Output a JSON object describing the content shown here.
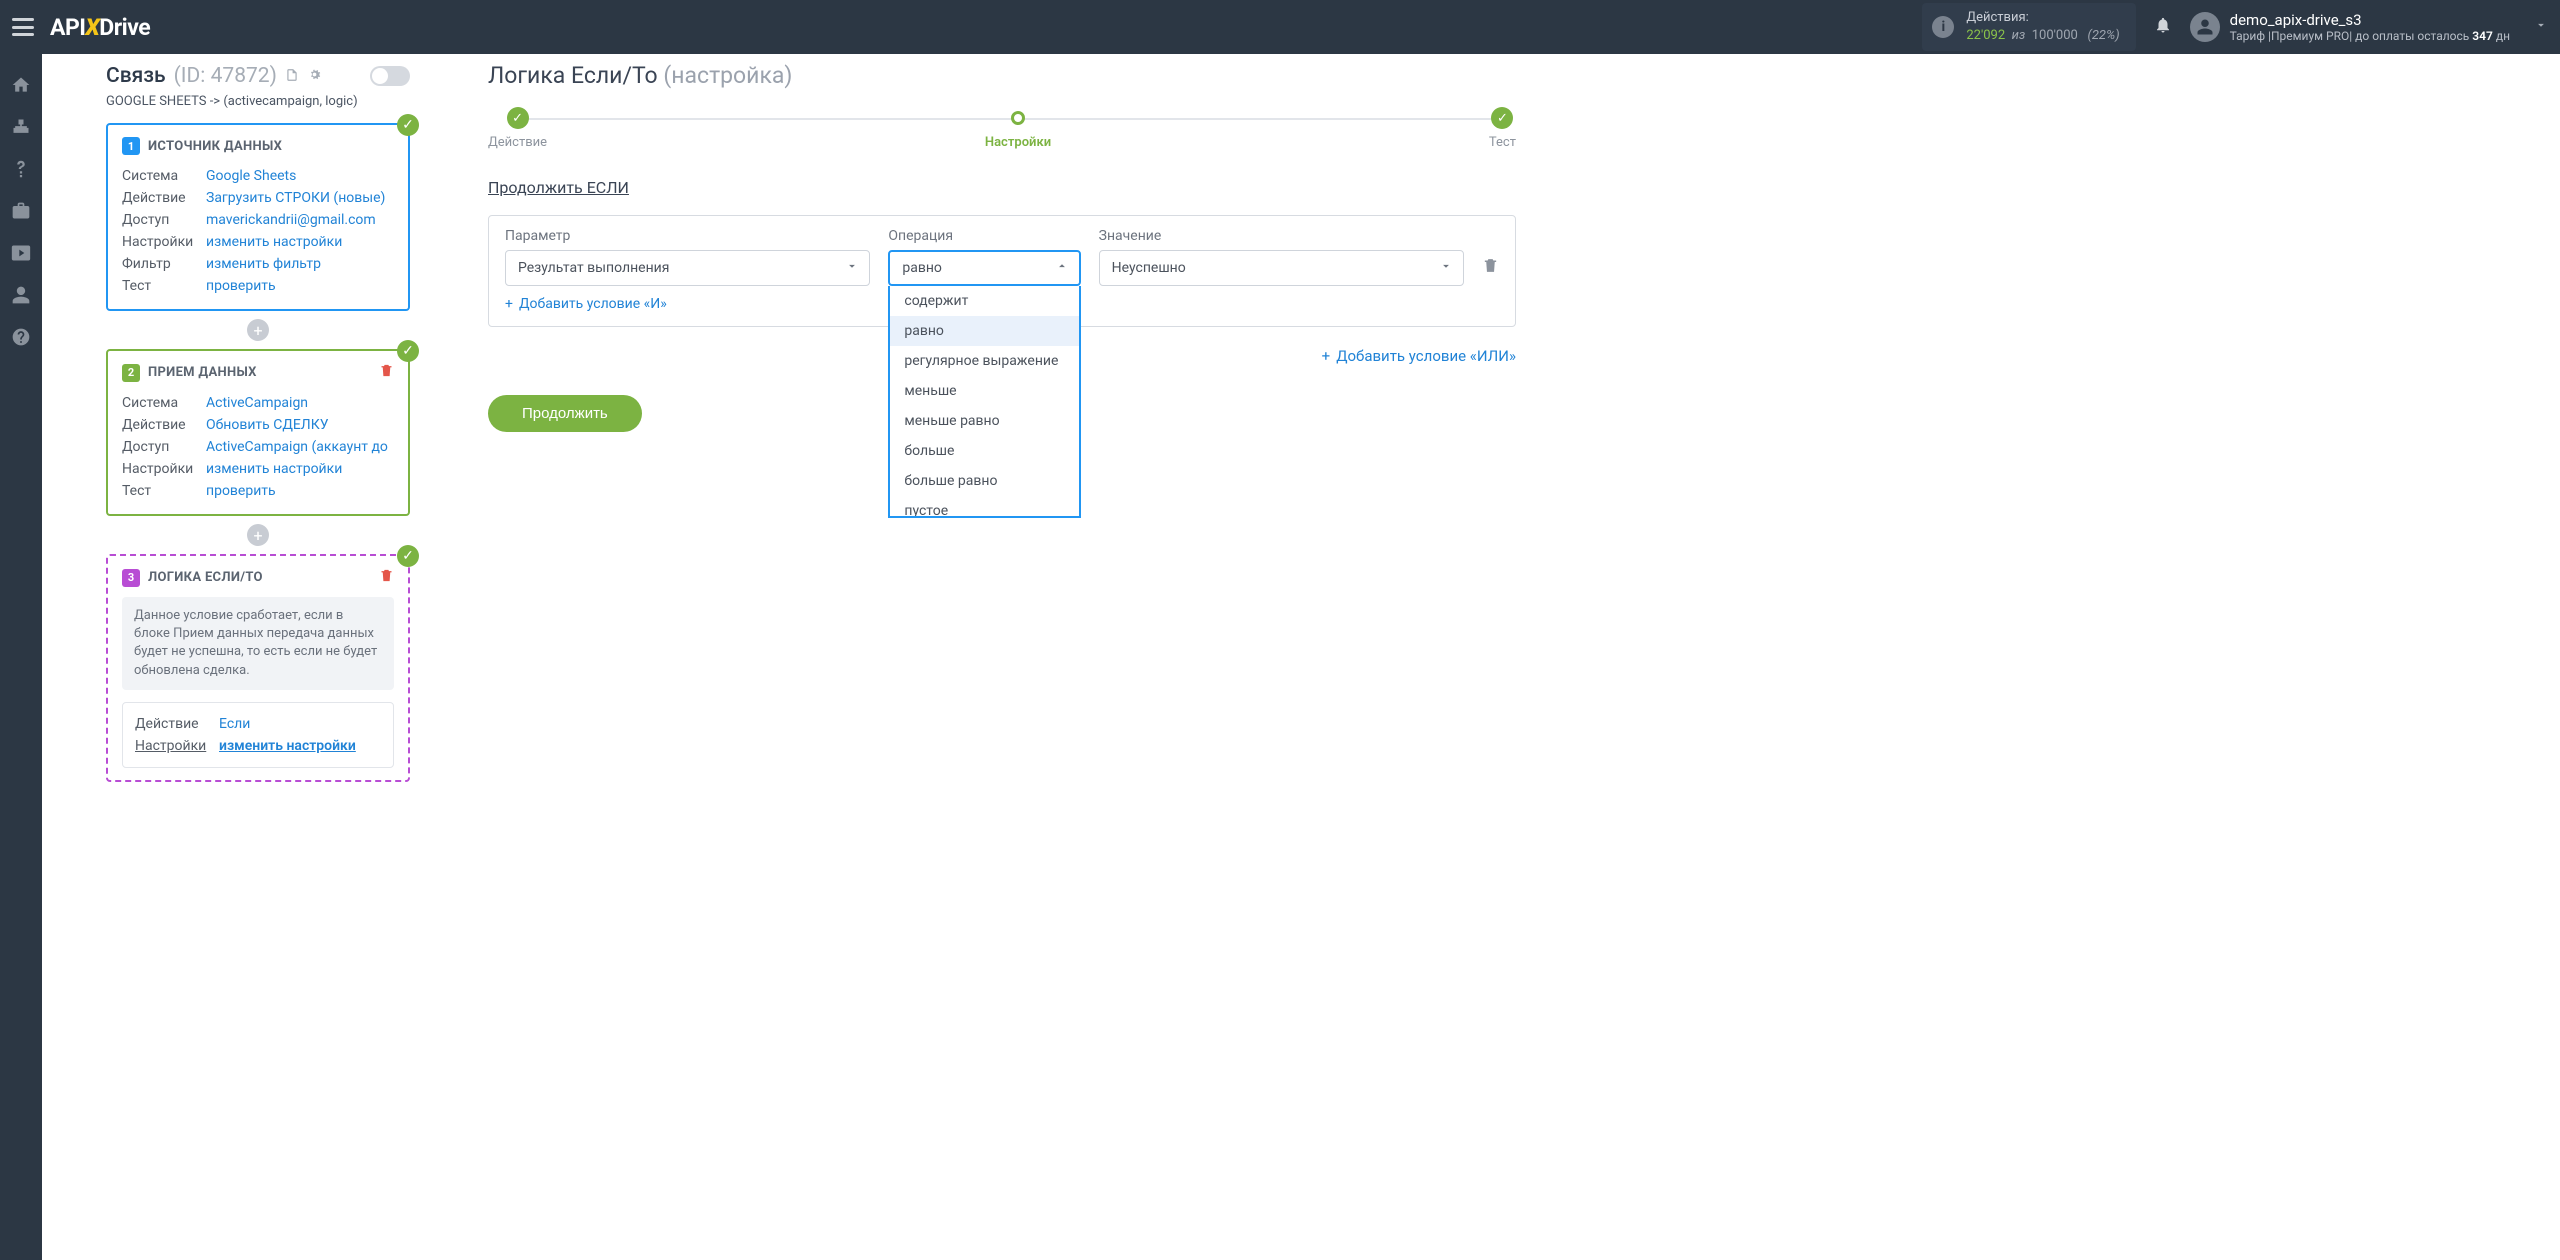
{
  "header": {
    "logo_a": "API",
    "logo_b": "Drive",
    "actions_label": "Действия:",
    "actions_count": "22'092",
    "actions_of": "из",
    "actions_total": "100'000",
    "actions_pct": "(22%)",
    "user_name": "demo_apix-drive_s3",
    "plan_prefix": "Тариф |",
    "plan_name": "Премиум PRO",
    "plan_suffix1": "| до оплаты осталось ",
    "plan_days": "347",
    "plan_suffix2": " дн"
  },
  "svz": {
    "title": "Связь",
    "id": "(ID: 47872)",
    "sub": "GOOGLE SHEETS -> (activecampaign, logic)"
  },
  "card1": {
    "num": "1",
    "title": "ИСТОЧНИК ДАННЫХ",
    "rows": {
      "k0": "Система",
      "v0": "Google Sheets",
      "k1": "Действие",
      "v1": "Загрузить СТРОКИ (новые)",
      "k2": "Доступ",
      "v2": "maverickandrii@gmail.com",
      "k3": "Настройки",
      "v3": "изменить настройки",
      "k4": "Фильтр",
      "v4": "изменить фильтр",
      "k5": "Тест",
      "v5": "проверить"
    }
  },
  "card2": {
    "num": "2",
    "title": "ПРИЕМ ДАННЫХ",
    "rows": {
      "k0": "Система",
      "v0": "ActiveCampaign",
      "k1": "Действие",
      "v1": "Обновить СДЕЛКУ",
      "k2": "Доступ",
      "v2": "ActiveCampaign (аккаунт до",
      "k3": "Настройки",
      "v3": "изменить настройки",
      "k4": "Тест",
      "v4": "проверить"
    }
  },
  "card3": {
    "num": "3",
    "title": "ЛОГИКА ЕСЛИ/ТО",
    "note": "Данное условие сработает, если в блоке Прием данных передача данных будет не успешна, то есть если не будет обновлена сделка.",
    "rows": {
      "k0": "Действие",
      "v0": "Если",
      "k1": "Настройки",
      "v1": "изменить настройки"
    }
  },
  "page": {
    "title": "Логика Если/То",
    "subtitle": "(настройка)",
    "steps": {
      "s0": "Действие",
      "s1": "Настройки",
      "s2": "Тест"
    },
    "section": "Продолжить ЕСЛИ"
  },
  "cond": {
    "lbl_param": "Параметр",
    "lbl_oper": "Операция",
    "lbl_val": "Значение",
    "param_val": "Результат выполнения",
    "oper_val": "равно",
    "val_val": "Неуспешно",
    "add_and": "Добавить условие «И»",
    "add_or": "Добавить условие «ИЛИ»",
    "options": {
      "o0": "содержит",
      "o1": "равно",
      "o2": "регулярное выражение",
      "o3": "меньше",
      "o4": "меньше равно",
      "o5": "больше",
      "o6": "больше равно",
      "o7": "пустое"
    }
  },
  "btn_continue": "Продолжить"
}
